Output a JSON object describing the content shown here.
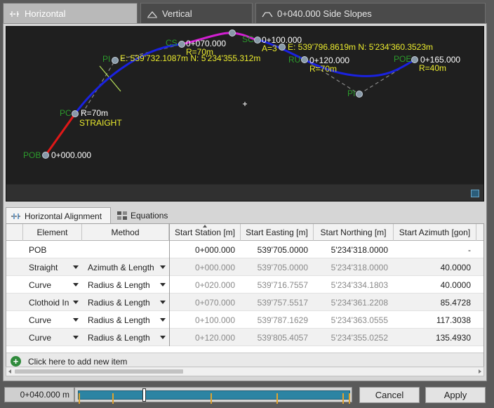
{
  "tabs": [
    {
      "label": "Horizontal",
      "icon": "horizontal-alignment-icon",
      "active": true
    },
    {
      "label": "Vertical",
      "icon": "vertical-alignment-icon",
      "active": false
    },
    {
      "label": "0+040.000 Side Slopes",
      "icon": "side-slopes-icon",
      "active": false
    }
  ],
  "plan": {
    "start_label": "POB",
    "start_station": "0+000.000",
    "pc_label": "PC",
    "pc_radius": "R=70m",
    "pc_type": "STRAIGHT",
    "pi1_label": "PI",
    "pi1_coords": "E: 539'732.1087m  N: 5'234'355.312m",
    "cs_label": "CS",
    "cs_station": "0+070.000",
    "cs_radius": "R=70m",
    "sc_label": "SC",
    "sc_station": "0+100.000",
    "sc_clothoid": "A=3",
    "cursor_coords": "E: 539'796.8619m  N: 5'234'360.3523m",
    "ru_label": "RU",
    "ru_station": "0+120.000",
    "ru_radius": "R=70m",
    "pi2_label": "PI",
    "poe_label": "POE",
    "poe_station": "0+165.000",
    "poe_radius": "R=40m"
  },
  "subtabs": [
    {
      "label": "Horizontal Alignment",
      "icon": "alignment-icon",
      "active": true
    },
    {
      "label": "Equations",
      "icon": "equations-icon",
      "active": false
    }
  ],
  "grid": {
    "columns": [
      "Element",
      "Method",
      "Start Station [m]",
      "Start Easting [m]",
      "Start Northing [m]",
      "Start Azimuth [gon]"
    ],
    "rows": [
      {
        "element": "POB",
        "method": "",
        "station": "0+000.000",
        "easting": "539'705.0000",
        "northing": "5'234'318.0000",
        "azimuth": "-"
      },
      {
        "element": "Straight",
        "method": "Azimuth & Length",
        "station": "0+000.000",
        "easting": "539'705.0000",
        "northing": "5'234'318.0000",
        "azimuth": "40.0000"
      },
      {
        "element": "Curve",
        "method": "Radius & Length",
        "station": "0+020.000",
        "easting": "539'716.7557",
        "northing": "5'234'334.1803",
        "azimuth": "40.0000"
      },
      {
        "element": "Clothoid In",
        "method": "Radius & Length",
        "station": "0+070.000",
        "easting": "539'757.5517",
        "northing": "5'234'361.2208",
        "azimuth": "85.4728"
      },
      {
        "element": "Curve",
        "method": "Radius & Length",
        "station": "0+100.000",
        "easting": "539'787.1629",
        "northing": "5'234'363.0555",
        "azimuth": "117.3038"
      },
      {
        "element": "Curve",
        "method": "Radius & Length",
        "station": "0+120.000",
        "easting": "539'805.4057",
        "northing": "5'234'355.0252",
        "azimuth": "135.4930"
      }
    ],
    "add_item": "Click here to add new item"
  },
  "bottom": {
    "station_value": "0+040.000 m",
    "slider_position": 0.245,
    "cancel_label": "Cancel",
    "apply_label": "Apply"
  },
  "colors": {
    "straight": "#e01818",
    "curve": "#1a22e0",
    "clothoid": "#d21fd2",
    "label_green": "#2c9a2c",
    "label_yellow": "#ecec2e",
    "node": "#8899a8"
  }
}
